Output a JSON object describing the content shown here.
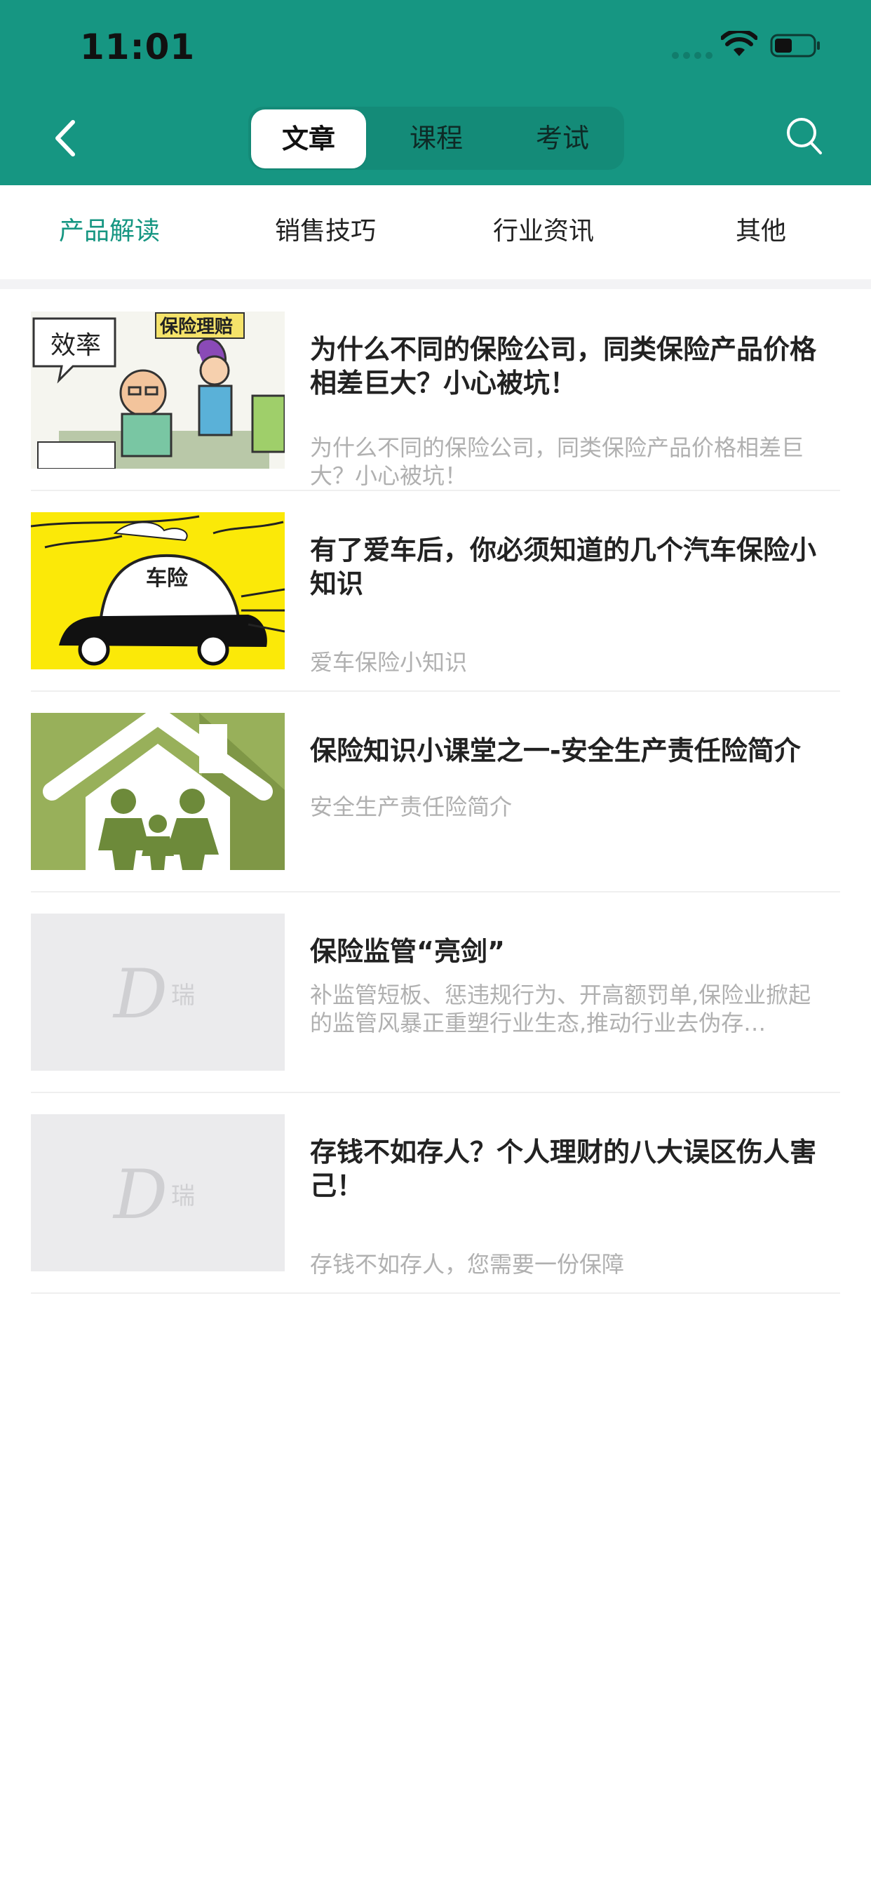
{
  "status_bar": {
    "time": "11:01"
  },
  "header": {
    "tabs": [
      {
        "label": "文章",
        "active": true
      },
      {
        "label": "课程",
        "active": false
      },
      {
        "label": "考试",
        "active": false
      }
    ],
    "icons": {
      "back": "chevron-left-icon",
      "search": "search-icon"
    }
  },
  "subtabs": [
    {
      "label": "产品解读",
      "active": true
    },
    {
      "label": "销售技巧",
      "active": false
    },
    {
      "label": "行业资讯",
      "active": false
    },
    {
      "label": "其他",
      "active": false
    }
  ],
  "articles": [
    {
      "title": "为什么不同的保险公司，同类保险产品价格相差巨大？小心被坑！",
      "summary": "为什么不同的保险公司，同类保险产品价格相差巨大？小心被坑！",
      "thumb": {
        "type": "cartoon-office",
        "bubble_text": "效率",
        "sign_text": "保险理赔"
      }
    },
    {
      "title": "有了爱车后，你必须知道的几个汽车保险小知识",
      "summary": "爱车保险小知识",
      "thumb": {
        "type": "cartoon-car",
        "label_text": "车险"
      }
    },
    {
      "title": "保险知识小课堂之一-安全生产责任险简介",
      "summary": "安全生产责任险简介",
      "thumb": {
        "type": "house-family"
      }
    },
    {
      "title": "保险监管“亮剑”",
      "summary": "补监管短板、惩违规行为、开高额罚单,保险业掀起的监管风暴正重塑行业生态,推动行业去伪存…",
      "thumb": {
        "type": "placeholder-logo",
        "logo_text": "瑞"
      }
    },
    {
      "title": "存钱不如存人？个人理财的八大误区伤人害己！",
      "summary": "存钱不如存人，您需要一份保障",
      "thumb": {
        "type": "placeholder-logo",
        "logo_text": "瑞"
      }
    }
  ],
  "colors": {
    "brand": "#169682",
    "title": "#222222",
    "summary": "#b0b0b0"
  }
}
